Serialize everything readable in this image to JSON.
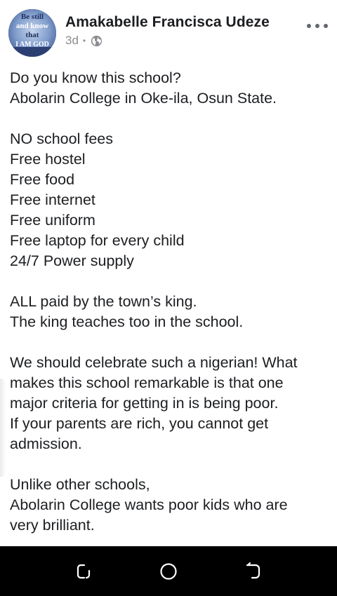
{
  "post": {
    "author": "Amakabelle Francisca Udeze",
    "time": "3d",
    "separator": "•",
    "privacy_icon": "globe-icon",
    "more_icon": "more-horizontal-icon",
    "avatar_text": [
      "Be still",
      "and know",
      "that",
      "I AM GOD"
    ],
    "lines": [
      "Do you know this school?",
      "Abolarin College in Oke-ila, Osun State.",
      "",
      "NO school fees",
      "Free hostel",
      "Free food",
      "Free internet",
      "Free uniform",
      "Free laptop for every child",
      "24/7 Power supply",
      "",
      "ALL paid by the town’s king.",
      "The king teaches too in the school.",
      "",
      "We should celebrate such a nigerian! What",
      "makes this school remarkable is that one",
      "major criteria for getting in is being poor.",
      "If your parents are rich, you cannot get",
      "admission.",
      "",
      "Unlike other schools,",
      "Abolarin College wants poor kids who are",
      "very brilliant."
    ]
  },
  "navbar": {
    "recents_icon": "recent-apps-icon",
    "home_icon": "home-icon",
    "back_icon": "back-icon"
  },
  "colors": {
    "text": "#1c1e21",
    "meta": "#8a8d91",
    "navbar": "#000000"
  }
}
